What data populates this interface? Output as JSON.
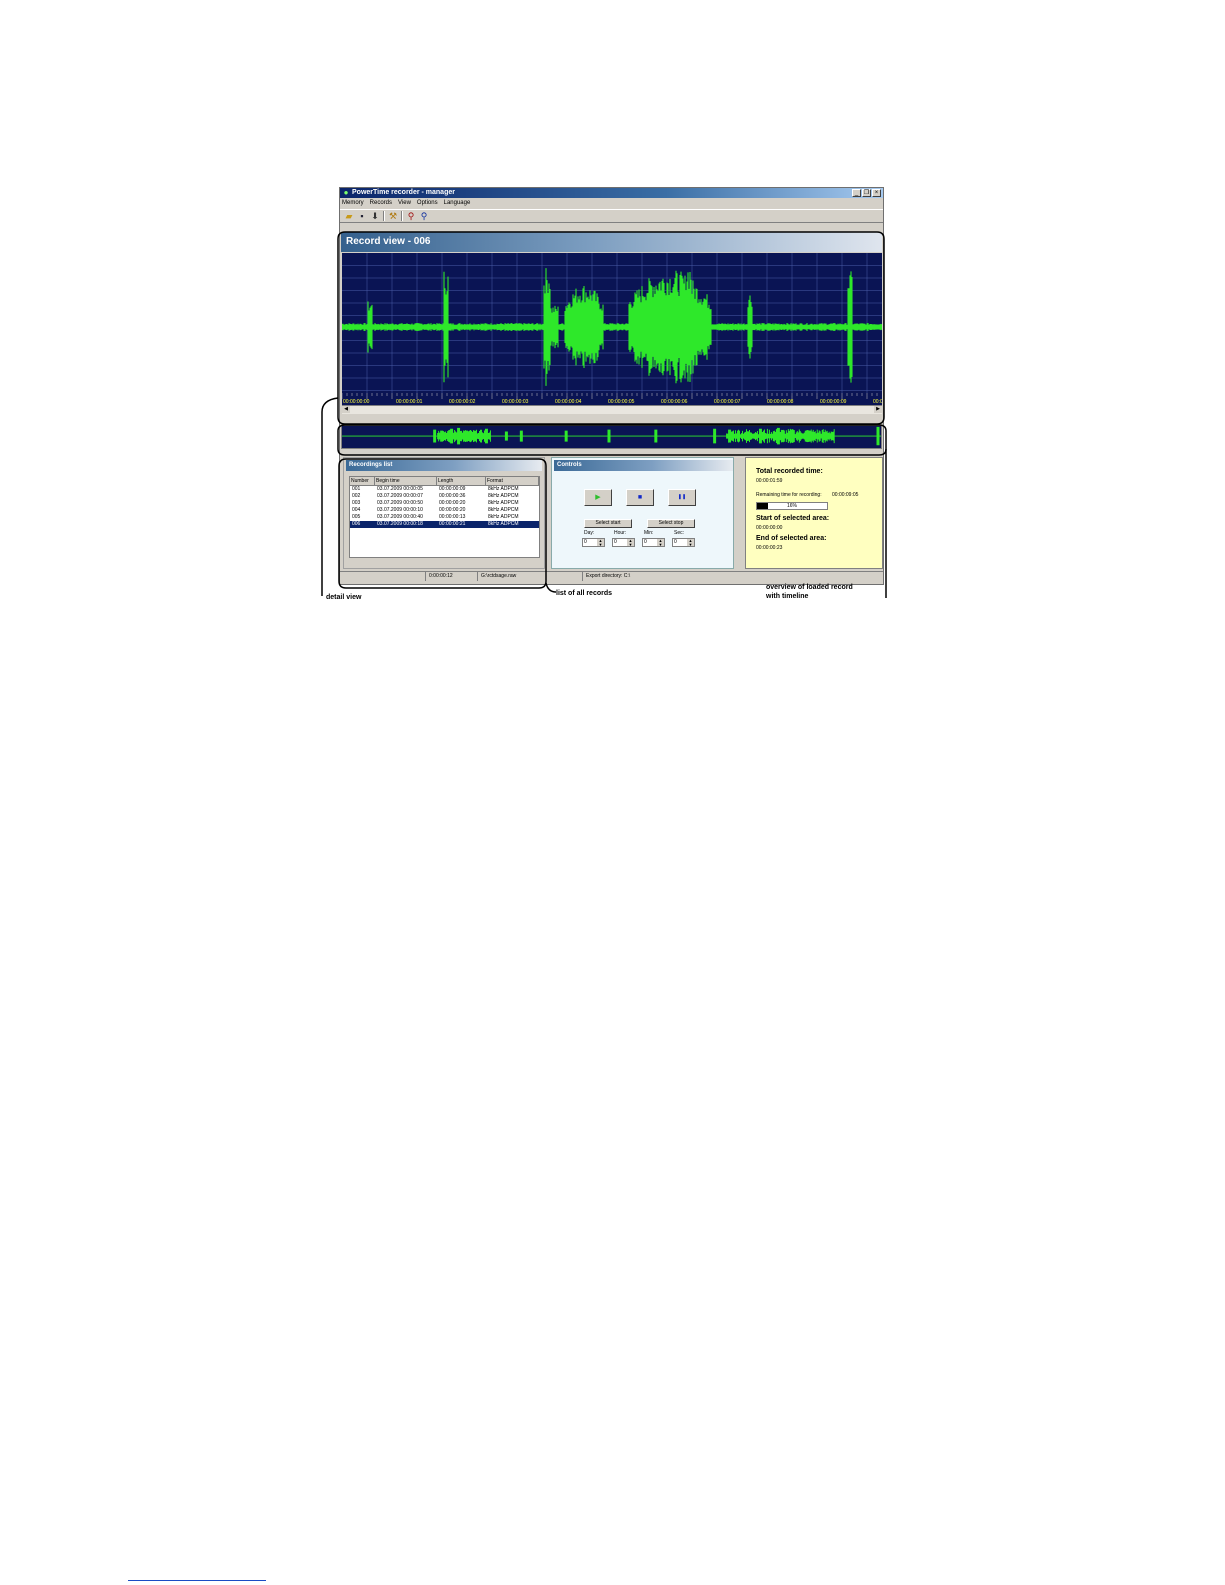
{
  "app": {
    "title": "PowerTime recorder - manager",
    "window_buttons": [
      "_",
      "❐",
      "×"
    ],
    "menu": [
      "Memory",
      "Records",
      "View",
      "Options",
      "Language"
    ],
    "toolbar_icons": [
      "open-icon",
      "save-icon",
      "download-icon",
      "tools-icon",
      "zoom-in-icon",
      "zoom-out-icon"
    ]
  },
  "record_view": {
    "title": "Record view - 006",
    "time_labels": [
      "00:00:00:00",
      "00:00:00:01",
      "00:00:00:02",
      "00:00:00:03",
      "00:00:00:04",
      "00:00:00:05",
      "00:00:00:06",
      "00:00:00:07",
      "00:00:00:08",
      "00:00:00:09",
      "00:00:00:10"
    ]
  },
  "recordings_list": {
    "title": "Recordings list",
    "columns": [
      "Number",
      "Begin time",
      "Length",
      "Format"
    ],
    "rows": [
      {
        "number": "001",
        "begin": "03.07.2009  00:00:05",
        "length": "00:00:00:09",
        "format": "8kHz ADPCM"
      },
      {
        "number": "002",
        "begin": "03.07.2009  00:00:07",
        "length": "00:00:00:36",
        "format": "8kHz ADPCM"
      },
      {
        "number": "003",
        "begin": "03.07.2009  00:00:50",
        "length": "00:00:00:20",
        "format": "8kHz ADPCM"
      },
      {
        "number": "004",
        "begin": "03.07.2009  00:00:10",
        "length": "00:00:00:20",
        "format": "8kHz ADPCM"
      },
      {
        "number": "005",
        "begin": "03.07.2009  00:00:40",
        "length": "00:00:00:13",
        "format": "8kHz ADPCM"
      },
      {
        "number": "006",
        "begin": "03.07.2009  00:00:18",
        "length": "00:00:00:21",
        "format": "8kHz ADPCM"
      }
    ],
    "selected_index": 5
  },
  "controls": {
    "title": "Controls",
    "play": "▶",
    "stop": "■",
    "pause": "❚❚",
    "select_start": "Select start",
    "select_stop": "Select stop",
    "spinners": [
      {
        "label": "Day:",
        "value": "0"
      },
      {
        "label": "Hour:",
        "value": "0"
      },
      {
        "label": "Min:",
        "value": "0"
      },
      {
        "label": "Sec:",
        "value": "0"
      }
    ]
  },
  "info": {
    "total_label": "Total recorded time:",
    "total_value": "00:00:01:59",
    "remaining_label": "Remaining time for recording:",
    "remaining_value": "00:00:09:05",
    "progress_text": "16%",
    "progress_fraction": 0.16,
    "start_label": "Start of selected area:",
    "start_value": "00:00:00:00",
    "end_label": "End of selected area:",
    "end_value": "00:00:00:23"
  },
  "statusbar": [
    "",
    "0:00:00:12",
    "G:\\rctdsage.raw",
    "Export directory: C:\\"
  ],
  "annotations": {
    "detail": "detail view",
    "list": "list of all records",
    "overview_line1": "overview of loaded record",
    "overview_line2": "with timeline"
  },
  "colors": {
    "waveform": "#2ee82a",
    "wave_bg": "#0a1454",
    "time_labels": "#ffff3c",
    "info_bg": "#ffffc0"
  }
}
